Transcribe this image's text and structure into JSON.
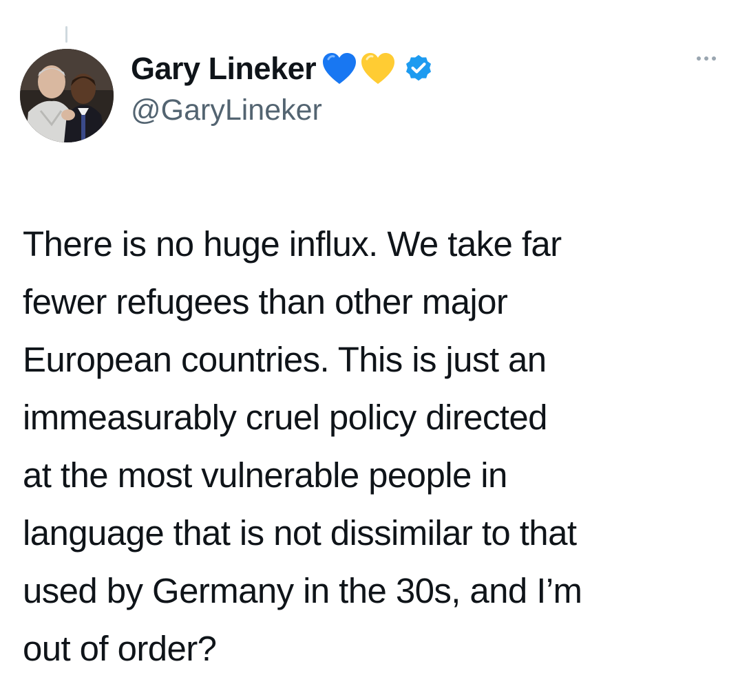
{
  "tweet": {
    "author": {
      "display_name": "Gary Lineker",
      "handle": "@GaryLineker",
      "name_emojis": [
        "blue-heart-icon",
        "yellow-heart-icon"
      ],
      "verified": true
    },
    "more_icon": "ellipsis-icon",
    "text_lines": [
      "There is no huge influx. We take far",
      "fewer refugees than other major",
      "European countries. This is just an",
      "immeasurably cruel policy directed",
      "at the most vulnerable people in",
      "language that is not dissimilar to that",
      "used by Germany in the 30s, and I’m",
      "out of order?"
    ]
  },
  "colors": {
    "text_primary": "#0f1419",
    "text_secondary": "#536471",
    "verified_blue": "#1d9bf0",
    "heart_blue": "#1877f2",
    "heart_yellow": "#ffcc33"
  }
}
